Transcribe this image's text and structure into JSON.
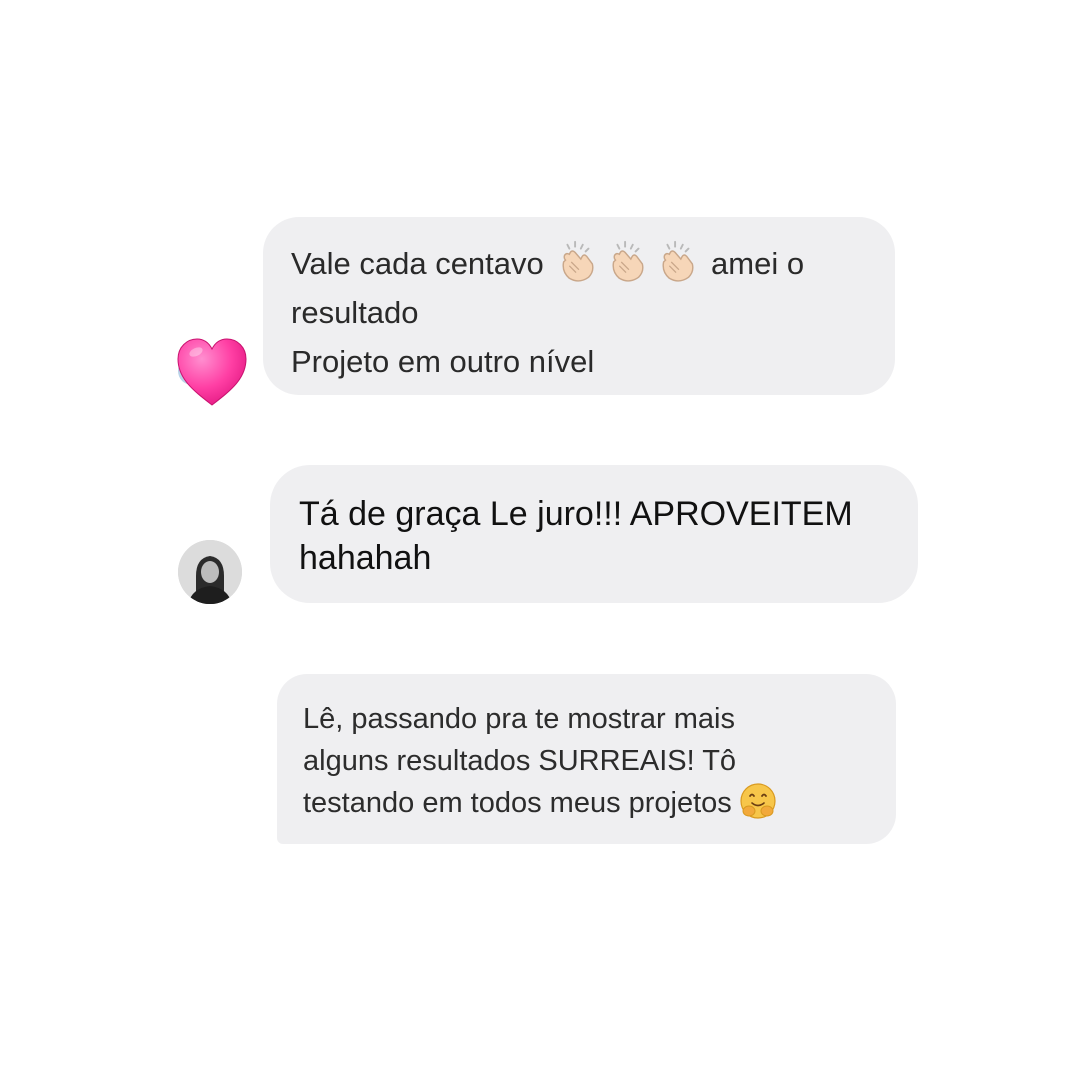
{
  "messages": [
    {
      "line1_before": "Vale cada centavo",
      "line1_after": "amei o",
      "line2": "resultado",
      "line3": "Projeto em outro nível",
      "emoji_icons": [
        "clapping-hands-icon",
        "clapping-hands-icon",
        "clapping-hands-icon"
      ],
      "reaction_icon": "pink-heart-icon"
    },
    {
      "text": "Tá de graça Le juro!!! APROVEITEM\nhahahah",
      "avatar_icon": "profile-photo-avatar"
    },
    {
      "text": "Lê, passando pra te mostrar mais\nalguns resultados SURREAIS! Tô\ntestando em todos meus projetos",
      "emoji_icon": "hugging-face-icon"
    }
  ],
  "colors": {
    "bubble_background": "#efeff1",
    "text": "#262626",
    "heart": "#ff3fa4"
  }
}
